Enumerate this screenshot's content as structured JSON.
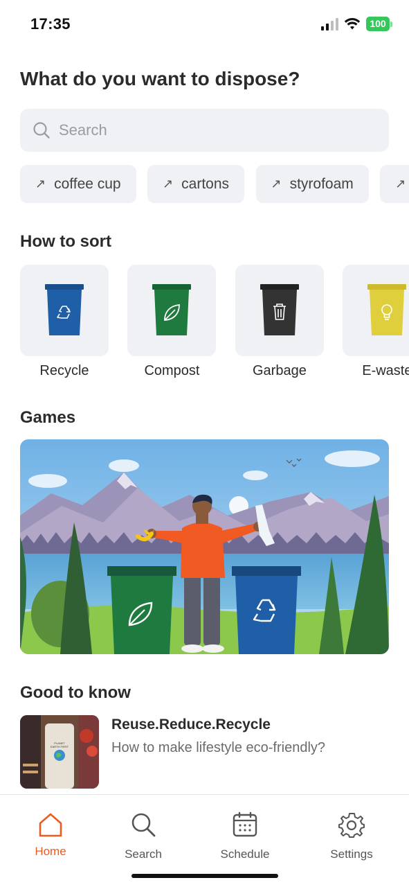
{
  "status": {
    "time": "17:35",
    "battery": "100",
    "signal_icon": "cellular-signal-icon",
    "wifi_icon": "wifi-icon"
  },
  "title": "What do you want to dispose?",
  "search": {
    "placeholder": "Search",
    "icon": "search-icon"
  },
  "suggestions": [
    {
      "label": "coffee cup",
      "icon": "trend-arrow-icon"
    },
    {
      "label": "cartons",
      "icon": "trend-arrow-icon"
    },
    {
      "label": "styrofoam",
      "icon": "trend-arrow-icon"
    }
  ],
  "sort": {
    "title": "How to sort",
    "bins": [
      {
        "label": "Recycle",
        "color": "#1f5fa8",
        "icon": "recycle-icon"
      },
      {
        "label": "Compost",
        "color": "#1f7a3f",
        "icon": "leaf-icon"
      },
      {
        "label": "Garbage",
        "color": "#333333",
        "icon": "trash-icon"
      },
      {
        "label": "E-waste",
        "color": "#e0cf3c",
        "icon": "lightbulb-icon"
      }
    ]
  },
  "games": {
    "title": "Games"
  },
  "good_to_know": {
    "title": "Good to know",
    "article": {
      "title": "Reuse.Reduce.Recycle",
      "subtitle": "How to make lifestyle eco-friendly?",
      "thumb_text": "PLANET EARTH FIRST"
    }
  },
  "tabs": [
    {
      "label": "Home",
      "icon": "home-icon",
      "active": true
    },
    {
      "label": "Search",
      "icon": "search-icon",
      "active": false
    },
    {
      "label": "Schedule",
      "icon": "calendar-icon",
      "active": false
    },
    {
      "label": "Settings",
      "icon": "gear-icon",
      "active": false
    }
  ],
  "colors": {
    "accent": "#ee5a1f",
    "chip_bg": "#f0f1f4",
    "text": "#2b2b2b"
  }
}
